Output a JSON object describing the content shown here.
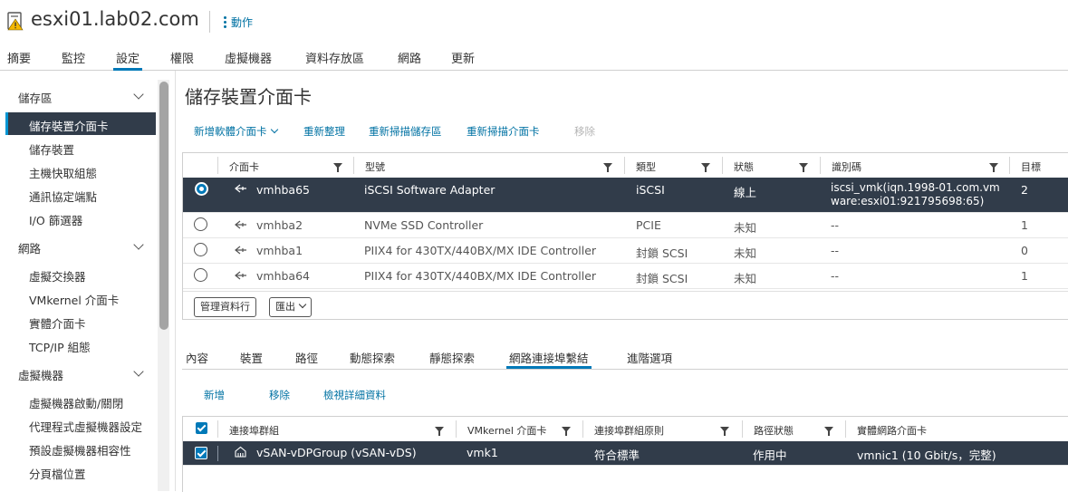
{
  "header": {
    "host": "esxi01.lab02.com",
    "actions_label": "動作"
  },
  "top_tabs": [
    "摘要",
    "監控",
    "設定",
    "權限",
    "虛擬機器",
    "資料存放區",
    "網路",
    "更新"
  ],
  "top_tab_active": "設定",
  "sidebar": {
    "groups": [
      {
        "label": "儲存區",
        "items": [
          "儲存裝置介面卡",
          "儲存裝置",
          "主機快取組態",
          "通訊協定端點",
          "I/O 篩選器"
        ]
      },
      {
        "label": "網路",
        "items": [
          "虛擬交換器",
          "VMkernel 介面卡",
          "實體介面卡",
          "TCP/IP 組態"
        ]
      },
      {
        "label": "虛擬機器",
        "items": [
          "虛擬機器啟動/關閉",
          "代理程式虛擬機器設定",
          "預設虛擬機器相容性",
          "分頁檔位置"
        ]
      }
    ],
    "active_item": "儲存裝置介面卡"
  },
  "main": {
    "title": "儲存裝置介面卡",
    "toolbar": [
      "新增軟體介面卡",
      "重新整理",
      "重新掃描儲存區",
      "重新掃描介面卡",
      "移除"
    ],
    "adapters_table": {
      "columns": [
        "介面卡",
        "型號",
        "類型",
        "狀態",
        "識別碼",
        "目標"
      ],
      "rows": [
        {
          "adapter": "vmhba65",
          "model": "iSCSI Software Adapter",
          "type": "iSCSI",
          "status": "線上",
          "identifier_line1": "iscsi_vmk(iqn.1998-01.com.vm",
          "identifier_line2": "ware:esxi01:921795698:65)",
          "targets": "2",
          "selected": true
        },
        {
          "adapter": "vmhba2",
          "model": "NVMe SSD Controller",
          "type": "PCIE",
          "status": "未知",
          "identifier_line1": "--",
          "identifier_line2": "",
          "targets": "1",
          "selected": false
        },
        {
          "adapter": "vmhba1",
          "model": "PIIX4 for 430TX/440BX/MX IDE Controller",
          "type": "封鎖 SCSI",
          "status": "未知",
          "identifier_line1": "--",
          "identifier_line2": "",
          "targets": "0",
          "selected": false
        },
        {
          "adapter": "vmhba64",
          "model": "PIIX4 for 430TX/440BX/MX IDE Controller",
          "type": "封鎖 SCSI",
          "status": "未知",
          "identifier_line1": "--",
          "identifier_line2": "",
          "targets": "1",
          "selected": false
        }
      ],
      "footer_buttons": [
        "管理資料行",
        "匯出"
      ]
    },
    "sub_tabs": [
      "內容",
      "裝置",
      "路徑",
      "動態探索",
      "靜態探索",
      "網路連接埠繫結",
      "進階選項"
    ],
    "sub_tab_active": "網路連接埠繫結",
    "binding_toolbar": [
      "新增",
      "移除",
      "檢視詳細資料"
    ],
    "binding_table": {
      "columns": [
        "連接埠群組",
        "VMkernel 介面卡",
        "連接埠群組原則",
        "路徑狀態",
        "實體網路介面卡"
      ],
      "rows": [
        {
          "port_group": "vSAN-vDPGroup (vSAN-vDS)",
          "vmkernel": "vmk1",
          "policy": "符合標準",
          "path_status": "作用中",
          "physical_nic": "vmnic1 (10 Gbit/s，完整)",
          "checked": true
        }
      ]
    }
  },
  "colors": {
    "accent": "#0079b8",
    "link": "#0072a3",
    "selected_row": "#313c4a",
    "warning": "#f5b800"
  },
  "icons": [
    "warning-host-icon",
    "kebab-icon",
    "chevron-down-icon",
    "filter-icon",
    "storage-adapter-icon",
    "port-group-icon",
    "checkbox-icon",
    "radio-icon"
  ]
}
